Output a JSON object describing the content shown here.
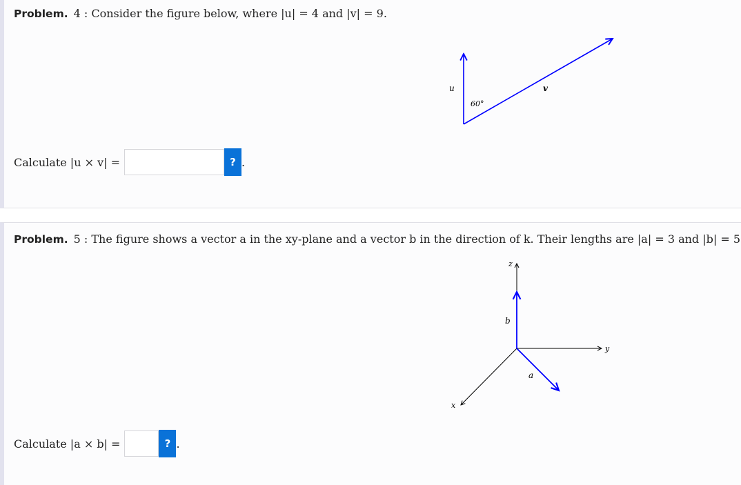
{
  "problems": [
    {
      "label": "Problem.",
      "number": "4 :",
      "statement": "Consider the figure below, where |u| = 4 and |v| = 9.",
      "figure": {
        "u_label": "u",
        "v_label": "v",
        "angle_label": "60°",
        "vector_color": "#0000ff"
      },
      "prompt": "Calculate |u × v| =",
      "answer_value": "",
      "help_button": "?",
      "trailing": "."
    },
    {
      "label": "Problem.",
      "number": "5 :",
      "statement": "The figure shows a vector a in the xy-plane and a vector b in the direction of k. Their lengths are |a| = 3 and |b| = 5.",
      "figure": {
        "x_label": "x",
        "y_label": "y",
        "z_label": "z",
        "a_label": "a",
        "b_label": "b",
        "vector_color": "#0000ff"
      },
      "prompt": "Calculate |a × b| =",
      "answer_value": "",
      "help_button": "?",
      "trailing": "."
    }
  ],
  "colors": {
    "help_button": "#0a72d8",
    "accent_border": "#e2e2ee"
  }
}
